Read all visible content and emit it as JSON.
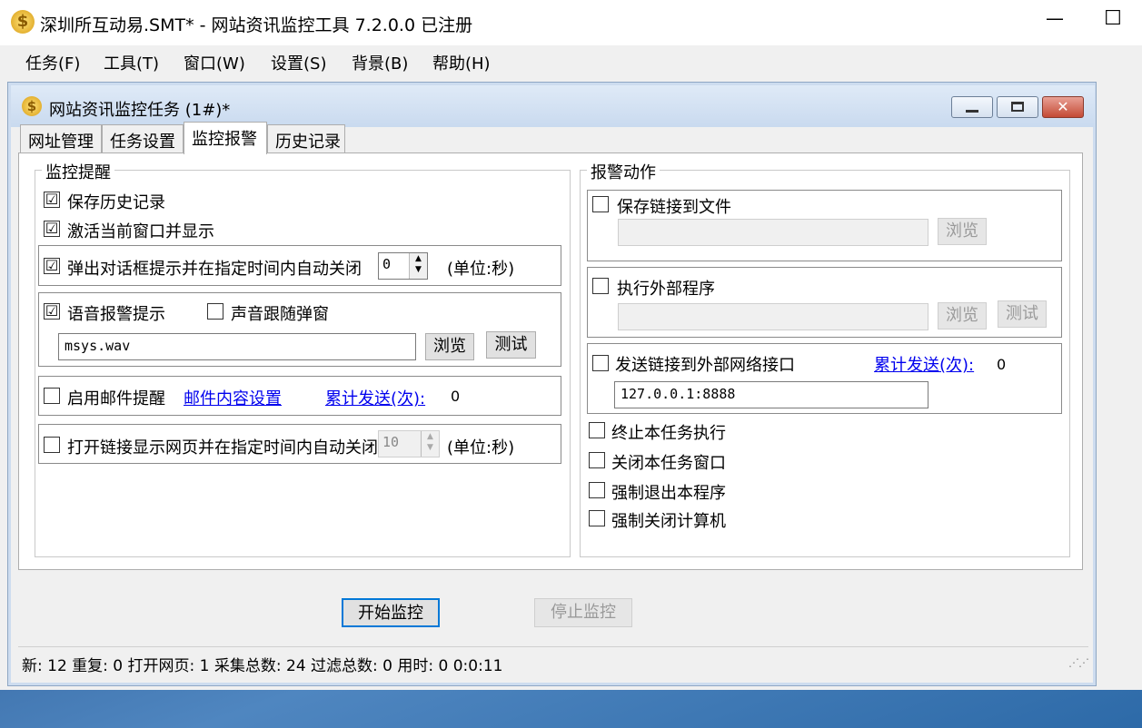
{
  "app": {
    "title": "深圳所互动易.SMT* - 网站资讯监控工具 7.2.0.0  已注册",
    "minimize": "—",
    "maximize": "☐"
  },
  "menu": [
    "任务(F)",
    "工具(T)",
    "窗口(W)",
    "设置(S)",
    "背景(B)",
    "帮助(H)"
  ],
  "task_window": {
    "title": "网站资讯监控任务  (1#)*"
  },
  "tabs": [
    "网址管理",
    "任务设置",
    "监控报警",
    "历史记录"
  ],
  "monitor": {
    "group_title": "监控提醒",
    "save_history": {
      "label": "保存历史记录",
      "checked": "☑"
    },
    "activate_window": {
      "label": "激活当前窗口并显示",
      "checked": "☑"
    },
    "popup": {
      "label": "弹出对话框提示并在指定时间内自动关闭",
      "checked": "☑",
      "value": "0",
      "unit": "(单位:秒)"
    },
    "voice": {
      "label": "语音报警提示",
      "checked": "☑",
      "follow_label": "声音跟随弹窗",
      "follow_checked": "",
      "file": "msys.wav",
      "browse": "浏览",
      "test": "测试"
    },
    "email": {
      "label": "启用邮件提醒",
      "checked": "",
      "settings_link": "邮件内容设置",
      "sent_link": "累计发送(次):",
      "sent_count": "0"
    },
    "open_link": {
      "label": "打开链接显示网页并在指定时间内自动关闭",
      "checked": "",
      "value": "10",
      "unit": "(单位:秒)"
    }
  },
  "alarm": {
    "group_title": "报警动作",
    "save_file": {
      "label": "保存链接到文件",
      "checked": "",
      "path": "",
      "browse": "浏览"
    },
    "exec_program": {
      "label": "执行外部程序",
      "checked": "",
      "path": "",
      "browse": "浏览",
      "test": "测试"
    },
    "send_network": {
      "label": "发送链接到外部网络接口",
      "checked": "",
      "sent_link": "累计发送(次):",
      "sent_count": "0",
      "address": "127.0.0.1:8888"
    },
    "stop_task": {
      "label": "终止本任务执行",
      "checked": ""
    },
    "close_window": {
      "label": "关闭本任务窗口",
      "checked": ""
    },
    "quit_program": {
      "label": "强制退出本程序",
      "checked": ""
    },
    "shutdown": {
      "label": "强制关闭计算机",
      "checked": ""
    }
  },
  "actions": {
    "start": "开始监控",
    "stop": "停止监控"
  },
  "status": "新:  12  重复:  0  打开网页:  1  采集总数:  24  过滤总数:  0  用时:  0 0:0:11"
}
